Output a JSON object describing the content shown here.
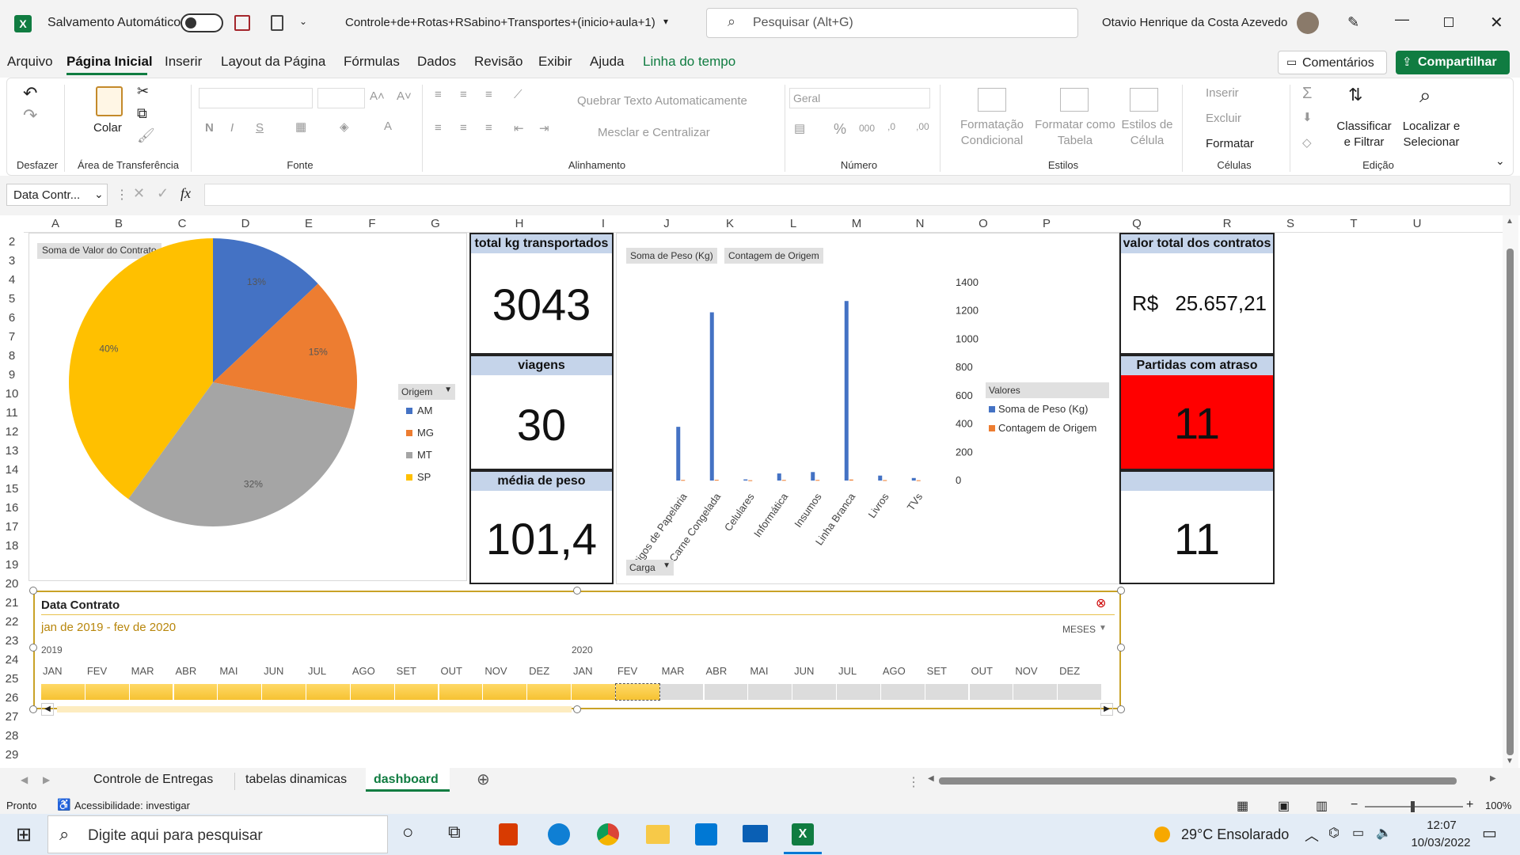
{
  "titlebar": {
    "autosave_label": "Salvamento Automático",
    "filename": "Controle+de+Rotas+RSabino+Transportes+(inicio+aula+1)",
    "search_placeholder": "Pesquisar (Alt+G)",
    "user_name": "Otavio Henrique da Costa Azevedo"
  },
  "menu_tabs": [
    "Arquivo",
    "Página Inicial",
    "Inserir",
    "Layout da Página",
    "Fórmulas",
    "Dados",
    "Revisão",
    "Exibir",
    "Ajuda",
    "Linha do tempo"
  ],
  "active_tab": "Página Inicial",
  "comments_label": "Comentários",
  "share_label": "Compartilhar",
  "ribbon": {
    "groups": [
      "Desfazer",
      "Área de Transferência",
      "Fonte",
      "Alinhamento",
      "Número",
      "Estilos",
      "Células",
      "Edição"
    ],
    "paste_label": "Colar",
    "wrap_text": "Quebrar Texto Automaticamente",
    "merge_center": "Mesclar e Centralizar",
    "number_format": "Geral",
    "cond_format": [
      "Formatação",
      "Condicional"
    ],
    "format_table": [
      "Formatar como",
      "Tabela"
    ],
    "cell_styles": [
      "Estilos de",
      "Célula"
    ],
    "insert": "Inserir",
    "delete": "Excluir",
    "format": "Formatar",
    "sort_filter": [
      "Classificar",
      "e Filtrar"
    ],
    "find_select": [
      "Localizar e",
      "Selecionar"
    ]
  },
  "formula": {
    "name_box": "Data Contr...",
    "fx": "fx",
    "content": ""
  },
  "columns": [
    "A",
    "B",
    "C",
    "D",
    "E",
    "F",
    "G",
    "H",
    "I",
    "J",
    "K",
    "L",
    "M",
    "N",
    "O",
    "P",
    "Q",
    "R",
    "S",
    "T",
    "U"
  ],
  "rows": [
    "2",
    "3",
    "4",
    "5",
    "6",
    "7",
    "8",
    "9",
    "10",
    "11",
    "12",
    "13",
    "14",
    "15",
    "16",
    "17",
    "18",
    "19",
    "20",
    "21",
    "22",
    "23",
    "24",
    "25",
    "26",
    "27",
    "28",
    "29"
  ],
  "pie": {
    "field_button": "Soma de Valor do Contrato",
    "legend_button": "Origem",
    "labels": [
      "13%",
      "15%",
      "32%",
      "40%"
    ]
  },
  "chart_data": [
    {
      "type": "pie",
      "categories": [
        "AM",
        "MG",
        "MT",
        "SP"
      ],
      "values": [
        13,
        15,
        32,
        40
      ],
      "colors": [
        "#4472c4",
        "#ed7d31",
        "#a5a5a5",
        "#ffc000"
      ],
      "title": "",
      "legend_title": "Origem"
    },
    {
      "type": "bar",
      "categories": [
        "Artigos de Papelaria",
        "Carne Congelada",
        "Celulares",
        "Informática",
        "Insumos",
        "Linha Branca",
        "Livros",
        "TVs"
      ],
      "series": [
        {
          "name": "Soma de Peso (Kg)",
          "values": [
            380,
            1190,
            8,
            50,
            60,
            1270,
            35,
            18
          ],
          "color": "#4472c4"
        },
        {
          "name": "Contagem de Origem",
          "values": [
            4,
            5,
            2,
            4,
            4,
            7,
            3,
            2
          ],
          "color": "#ed7d31"
        }
      ],
      "ylim": [
        0,
        1400
      ],
      "yticks": [
        "0",
        "200",
        "400",
        "600",
        "800",
        "1000",
        "1200",
        "1400"
      ],
      "legend_title": "Valores",
      "field_buttons": [
        "Soma de Peso (Kg)",
        "Contagem de Origem"
      ],
      "axis_button": "Carga",
      "legend_placement": "right"
    }
  ],
  "kpis": {
    "total_kg_label": "total kg transportados",
    "total_kg_value": "3043",
    "viagens_label": "viagens",
    "viagens_value": "30",
    "media_label": "média de peso",
    "media_value": "101,4",
    "valor_label": "valor total dos contratos",
    "valor_currency": "R$",
    "valor_value": "25.657,21",
    "atraso_label": "Partidas com atraso",
    "atraso_value": "11",
    "extra_value": "11"
  },
  "timeline": {
    "title": "Data Contrato",
    "range": "jan de 2019 - fev de 2020",
    "level": "MESES",
    "years": [
      "2019",
      "2020"
    ],
    "months": [
      "JAN",
      "FEV",
      "MAR",
      "ABR",
      "MAI",
      "JUN",
      "JUL",
      "AGO",
      "SET",
      "OUT",
      "NOV",
      "DEZ",
      "JAN",
      "FEV",
      "MAR",
      "ABR",
      "MAI",
      "JUN",
      "JUL",
      "AGO",
      "SET",
      "OUT",
      "NOV",
      "DEZ"
    ],
    "selected_count": 14
  },
  "sheets": [
    "Controle de Entregas",
    "tabelas dinamicas",
    "dashboard"
  ],
  "active_sheet": "dashboard",
  "status": {
    "ready": "Pronto",
    "accessibility": "Acessibilidade: investigar",
    "zoom": "100%"
  },
  "taskbar": {
    "search_placeholder": "Digite aqui para pesquisar",
    "weather": "29°C  Ensolarado",
    "time": "12:07",
    "date": "10/03/2022"
  }
}
